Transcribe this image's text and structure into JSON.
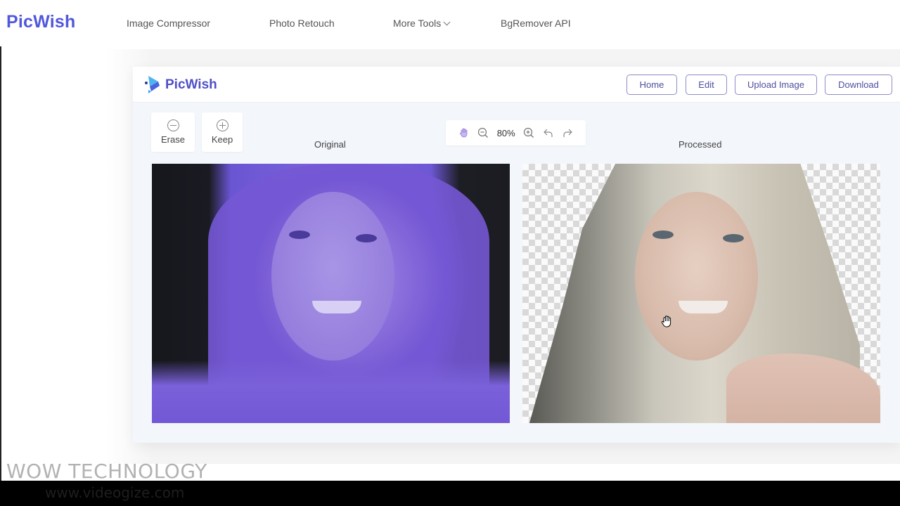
{
  "site": {
    "logo": "PicWish",
    "nav": [
      {
        "label": "Image Compressor"
      },
      {
        "label": "Photo Retouch"
      },
      {
        "label": "More Tools",
        "icon": "chevron-down-icon"
      },
      {
        "label": "BgRemover API"
      }
    ]
  },
  "app": {
    "logo": "PicWish",
    "header_buttons": {
      "home": "Home",
      "edit": "Edit",
      "upload": "Upload Image",
      "download": "Download"
    },
    "tools": {
      "erase": "Erase",
      "keep": "Keep"
    },
    "zoom": {
      "percent": "80%",
      "icons": [
        "hand-icon",
        "zoom-out-icon",
        "zoom-in-icon",
        "undo-icon",
        "redo-icon"
      ]
    },
    "panes": {
      "original_title": "Original",
      "processed_title": "Processed"
    },
    "colors": {
      "brand": "#5258dc",
      "button_border": "#8b8dc7",
      "button_text": "#4d4f9f",
      "panel_bg": "#f3f6fa"
    }
  },
  "watermark": {
    "title": "WOW TECHNOLOGY",
    "url": "www.videogize.com"
  }
}
